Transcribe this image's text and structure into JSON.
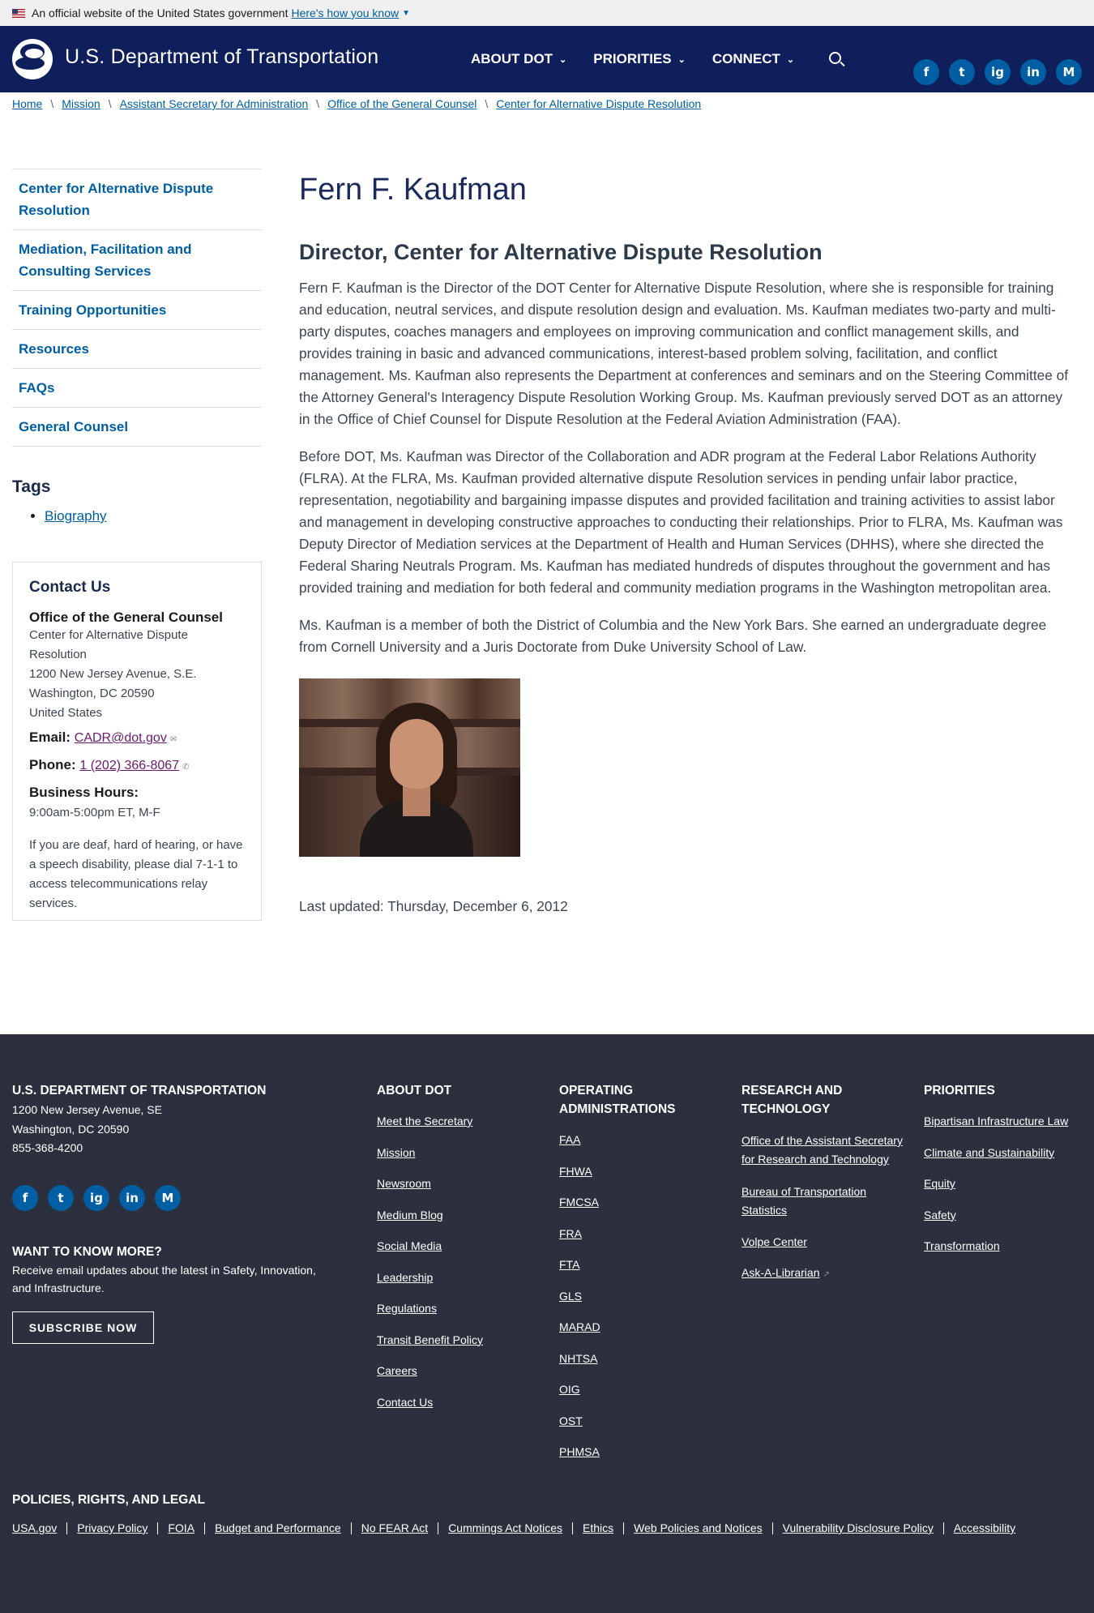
{
  "gov_banner": {
    "text": "An official website of the United States government",
    "link": "Here's how you know"
  },
  "header": {
    "site_title": "U.S. Department of Transportation",
    "nav": [
      {
        "label": "ABOUT DOT"
      },
      {
        "label": "PRIORITIES"
      },
      {
        "label": "CONNECT"
      }
    ],
    "social": [
      "f",
      "t",
      "ig",
      "in",
      "M"
    ]
  },
  "breadcrumb": [
    "Home",
    "Mission",
    "Assistant Secretary for Administration",
    "Office of the General Counsel",
    "Center for Alternative Dispute Resolution"
  ],
  "sidebar": {
    "nav": [
      "Center for Alternative Dispute Resolution",
      "Mediation, Facilitation and Consulting Services",
      "Training Opportunities",
      "Resources",
      "FAQs",
      "General Counsel"
    ],
    "tags_title": "Tags",
    "tags": [
      "Biography"
    ],
    "contact": {
      "title": "Contact Us",
      "org": "Office of the General Counsel",
      "lines": [
        "Center for Alternative Dispute Resolution",
        "1200 New Jersey Avenue, S.E.",
        "Washington, DC 20590",
        "United States"
      ],
      "email_label": "Email:",
      "email": "CADR@dot.gov",
      "phone_label": "Phone:",
      "phone": "1 (202) 366-8067",
      "hours_label": "Business Hours:",
      "hours": "9:00am-5:00pm ET, M-F",
      "note": "If you are deaf, hard of hearing, or have a speech disability, please dial 7-1-1 to access telecommunications relay services."
    }
  },
  "main": {
    "title": "Fern F. Kaufman",
    "subtitle": "Director, Center for Alternative Dispute Resolution",
    "paragraphs": [
      "Fern F. Kaufman is the Director of the DOT Center for Alternative Dispute Resolution, where she is responsible for training and education, neutral services, and dispute resolution design and evaluation.  Ms. Kaufman mediates two-party and multi-party disputes, coaches managers and employees on improving communication and conflict management skills,  and provides training in basic and advanced communications, interest-based problem solving, facilitation, and conflict management. Ms. Kaufman also represents the Department at conferences and seminars and on the Steering Committee of the Attorney General's Interagency Dispute Resolution Working Group.  Ms. Kaufman previously served DOT as an attorney in the Office of Chief Counsel for Dispute Resolution at the Federal Aviation Administration (FAA).",
      "Before DOT, Ms. Kaufman was Director of the Collaboration and ADR program at the Federal Labor Relations Authority (FLRA).  At the FLRA, Ms. Kaufman provided alternative dispute Resolution services in pending unfair labor practice, representation, negotiability and bargaining impasse disputes and provided facilitation and training activities to assist labor and management in developing constructive approaches to conducting their relationships.  Prior to FLRA, Ms. Kaufman was Deputy Director of Mediation services at the Department of Health and Human Services (DHHS), where she directed the Federal Sharing Neutrals Program.  Ms. Kaufman has mediated hundreds of disputes throughout the government and has provided training and mediation for both federal and community mediation programs in the Washington metropolitan area.",
      "Ms. Kaufman is a member of both the District of Columbia and the New York Bars.  She earned an undergraduate degree from Cornell University and a Juris Doctorate from Duke University School of Law."
    ],
    "last_updated": "Last updated: Thursday, December 6, 2012"
  },
  "footer": {
    "org_title": "U.S. DEPARTMENT OF TRANSPORTATION",
    "address": [
      "1200 New Jersey Avenue, SE",
      "Washington, DC 20590",
      "855-368-4200"
    ],
    "social": [
      "f",
      "t",
      "ig",
      "in",
      "M"
    ],
    "want_title": "WANT TO KNOW MORE?",
    "want_text": "Receive email updates about the latest in Safety, Innovation, and Infrastructure.",
    "subscribe": "SUBSCRIBE NOW",
    "columns": [
      {
        "title": "ABOUT DOT",
        "links": [
          "Meet the Secretary",
          "Mission",
          "Newsroom",
          "Medium Blog",
          "Social Media",
          "Leadership",
          "Regulations",
          "Transit Benefit Policy",
          "Careers",
          "Contact Us"
        ]
      },
      {
        "title": "OPERATING ADMINISTRATIONS",
        "links": [
          "FAA",
          "FHWA",
          "FMCSA",
          "FRA",
          "FTA",
          "GLS",
          "MARAD",
          "NHTSA",
          "OIG",
          "OST",
          "PHMSA"
        ]
      },
      {
        "title": "RESEARCH AND TECHNOLOGY",
        "links": [
          "Office of the Assistant Secretary for Research and Technology",
          "Bureau of Transportation Statistics",
          "Volpe Center",
          "Ask-A-Librarian"
        ]
      },
      {
        "title": "PRIORITIES",
        "links": [
          "Bipartisan Infrastructure Law",
          "Climate and Sustainability",
          "Equity",
          "Safety",
          "Transformation"
        ]
      }
    ],
    "policies_title": "POLICIES, RIGHTS, AND LEGAL",
    "policies": [
      "USA.gov",
      "Privacy Policy",
      "FOIA",
      "Budget and Performance",
      "No FEAR Act",
      "Cummings Act Notices",
      "Ethics",
      "Web Policies and Notices",
      "Vulnerability Disclosure Policy",
      "Accessibility"
    ]
  },
  "colors": {
    "header_bg": "#0e1f5b",
    "footer_bg": "#2c303e",
    "link": "#005ea2",
    "social": "#005ea2"
  }
}
